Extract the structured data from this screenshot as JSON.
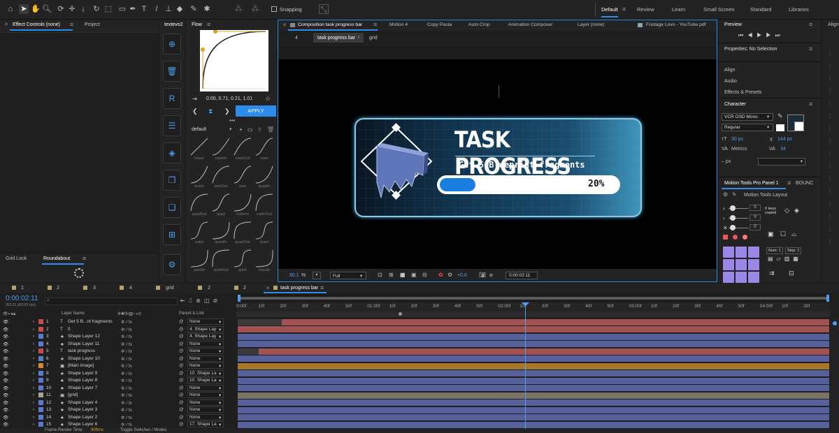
{
  "toolbar": {
    "snapping_label": "Snapping",
    "workspaces": [
      "Default",
      "Review",
      "Learn",
      "Small Screen",
      "Standard",
      "Libraries"
    ]
  },
  "left_panel": {
    "tabs": [
      "Effect Controls (none)",
      "Project"
    ],
    "bottom_tabs": [
      "Grid Lock",
      "Roundabout"
    ]
  },
  "textevo": {
    "title": "textevo2"
  },
  "flow": {
    "title": "Flow",
    "curve_values": "0.00, 0.71, 0.21, 1.01",
    "apply_label": "APPLY",
    "preset_select": "default",
    "presets": [
      "linear",
      "easeIn",
      "easeOut",
      "ease",
      "sineIn",
      "sineOut",
      "sine",
      "quadIn",
      "quadOut",
      "quad",
      "cubicIn",
      "cubicOut",
      "cubic",
      "quartIn",
      "quartOut",
      "quart",
      "quintIn",
      "quintOut",
      "quint",
      "expoIn"
    ]
  },
  "comp": {
    "tabs": [
      "Composition task progress bar",
      "Motion 4",
      "Copy Pasta",
      "Auto Crop",
      "Animation Composer",
      "Layer (none)",
      "Footage Lovo - YouTube.pdf"
    ],
    "breadcrumb": [
      "4",
      "task progress bar",
      "grid"
    ],
    "card_title": "TASK PROGRESS",
    "card_subtitle": "Get 5 Blueprint fragments",
    "progress_text": "20%",
    "progress_value": 0.2,
    "zoom": "80.1",
    "zoom_unit": "%",
    "resolution": "Full",
    "exposure": "+0.0",
    "timecode": "0:00:02:11"
  },
  "right": {
    "preview_title": "Preview",
    "properties_title": "Properties: No Selection",
    "sections": [
      "Align",
      "Audio",
      "Effects & Presets"
    ],
    "character_title": "Character",
    "font": "VCR OSD Mono",
    "style": "Regular",
    "size": "30 px",
    "leading": "144 px",
    "kerning": "Metrics",
    "tracking": "34",
    "px_label": "– px",
    "mtp_tabs": [
      "Motion Tools Pro Panel 1",
      "BOUNC"
    ],
    "mtp_layout": "Motion Tools Layout",
    "keys_copied": "0 keys copied",
    "num_label": "Num: 1",
    "step_label": "Step: 1",
    "slider_values": [
      "0",
      "0",
      "0"
    ],
    "align_label": "Align"
  },
  "timeline": {
    "tabs": [
      "1",
      "2",
      "3",
      "4",
      "grid",
      "2",
      "2",
      "task progress bar"
    ],
    "timecode": "0:00:02:11",
    "fps": "00131 (60.00 fps)",
    "col_layer_name": "Layer Name",
    "col_parent": "Parent & Link",
    "ruler": [
      "0:00f",
      "10f",
      "20f",
      "30f",
      "40f",
      "50f",
      "01:00f",
      "10f",
      "20f",
      "30f",
      "40f",
      "50f",
      "02:00f",
      "10f",
      "20f",
      "30f",
      "40f",
      "50f",
      "03:00f",
      "10f",
      "20f",
      "30f",
      "40f",
      "50f",
      "04:00f",
      "10f",
      "20f"
    ],
    "layers": [
      {
        "num": "1",
        "type": "T",
        "name": "Get 5 B...nt fragments",
        "parent": "None",
        "color": "#c74d4d",
        "bar": "#a05252",
        "start": 0.075
      },
      {
        "num": "2",
        "type": "T",
        "name": "0",
        "parent": "4. Shape Lay",
        "color": "#c74d4d",
        "bar": "#a05252",
        "start": 0
      },
      {
        "num": "3",
        "type": "★",
        "name": "Shape Layer 12",
        "parent": "4. Shape Lay",
        "color": "#5a7acb",
        "bar": "#56609b",
        "start": 0
      },
      {
        "num": "4",
        "type": "★",
        "name": "Shape Layer 11",
        "parent": "None",
        "color": "#5a7acb",
        "bar": "#56609b",
        "start": 0
      },
      {
        "num": "5",
        "type": "T",
        "name": "task progress",
        "parent": "None",
        "color": "#c74d4d",
        "bar": "#a05252",
        "start": 0.036
      },
      {
        "num": "6",
        "type": "★",
        "name": "Shape Layer 10",
        "parent": "None",
        "color": "#5a7acb",
        "bar": "#56609b",
        "start": 0
      },
      {
        "num": "7",
        "type": "▣",
        "name": "[Main image]",
        "parent": "None",
        "color": "#d38a2a",
        "bar": "#a7772e",
        "start": 0
      },
      {
        "num": "8",
        "type": "★",
        "name": "Shape Layer 9",
        "parent": "10. Shape La",
        "color": "#5a7acb",
        "bar": "#56609b",
        "start": 0
      },
      {
        "num": "9",
        "type": "★",
        "name": "Shape Layer 8",
        "parent": "10. Shape La",
        "color": "#5a7acb",
        "bar": "#56609b",
        "start": 0
      },
      {
        "num": "10",
        "type": "★",
        "name": "Shape Layer 7",
        "parent": "None",
        "color": "#5a7acb",
        "bar": "#56609b",
        "start": 0
      },
      {
        "num": "11",
        "type": "▣",
        "name": "[grid]",
        "parent": "None",
        "color": "#a9a39a",
        "bar": "#7a7468",
        "start": 0
      },
      {
        "num": "12",
        "type": "★",
        "name": "Shape Layer 4",
        "parent": "None",
        "color": "#5a7acb",
        "bar": "#56609b",
        "start": 0
      },
      {
        "num": "13",
        "type": "★",
        "name": "Shape Layer 3",
        "parent": "None",
        "color": "#5a7acb",
        "bar": "#56609b",
        "start": 0
      },
      {
        "num": "14",
        "type": "★",
        "name": "Shape Layer 2",
        "parent": "None",
        "color": "#5a7acb",
        "bar": "#56609b",
        "start": 0
      },
      {
        "num": "15",
        "type": "★",
        "name": "Shape Layer 6",
        "parent": "17. Shape La",
        "color": "#5a7acb",
        "bar": "#56609b",
        "start": 0
      }
    ],
    "status_render": "Frame Render Time:",
    "status_render_value": "909ms",
    "status_toggle": "Toggle Switches / Modes"
  }
}
